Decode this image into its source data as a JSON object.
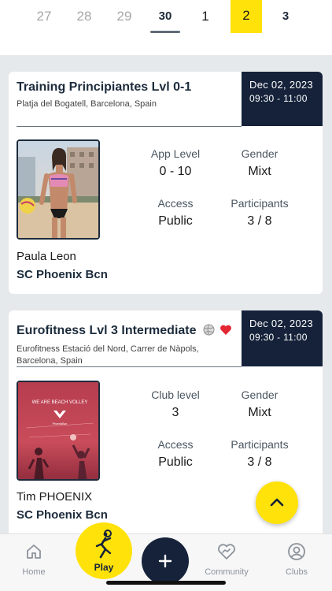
{
  "date_strip": {
    "days": [
      "27",
      "28",
      "29",
      "30",
      "1",
      "2",
      "3"
    ],
    "selected_day": "2"
  },
  "cards": [
    {
      "title": "Training Principiantes Lvl 0-1",
      "address": "Platja del Bogatell, Barcelona, Spain",
      "date": "Dec 02, 2023",
      "time": "09:30 - 11:00",
      "level_label": "App Level",
      "level_value": "0 - 10",
      "gender_label": "Gender",
      "gender_value": "Mixt",
      "access_label": "Access",
      "access_value": "Public",
      "participants_label": "Participants",
      "participants_value": "3 / 8",
      "coach": "Paula Leon",
      "club": "SC Phoenix Bcn"
    },
    {
      "title": "Eurofitness Lvl 3 Intermediate",
      "address": "Eurofitness Estació del Nord, Carrer de Nàpols, Barcelona, Spain",
      "date": "Dec 02, 2023",
      "time": "09:30 - 11:00",
      "level_label": "Club level",
      "level_value": "3",
      "gender_label": "Gender",
      "gender_value": "Mixt",
      "access_label": "Access",
      "access_value": "Public",
      "participants_label": "Participants",
      "participants_value": "3 / 8",
      "coach": "Tim PHOENIX",
      "club": "SC Phoenix Bcn",
      "poster_text": "WE ARE BEACH VOLLEY",
      "poster_brand": "PhoenixBcn"
    }
  ],
  "nav": {
    "home": "Home",
    "play": "Play",
    "community": "Community",
    "clubs": "Clubs"
  },
  "colors": {
    "accent": "#ffe20a",
    "navy": "#15223a",
    "background": "#e6e9ec"
  }
}
